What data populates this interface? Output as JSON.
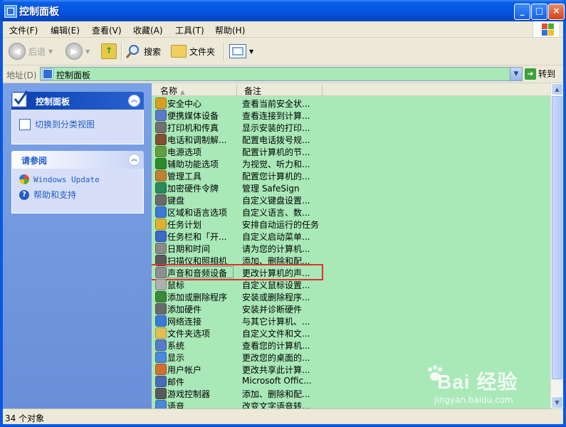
{
  "window": {
    "title": "控制面板"
  },
  "title_buttons": {
    "minimize": "_",
    "maximize": "□",
    "close": "×"
  },
  "menu": [
    "文件(F)",
    "编辑(E)",
    "查看(V)",
    "收藏(A)",
    "工具(T)",
    "帮助(H)"
  ],
  "toolbar": {
    "back": "后退",
    "search": "搜索",
    "folders": "文件夹"
  },
  "address": {
    "label": "地址(D)",
    "value": "控制面板",
    "go": "转到"
  },
  "left_panels": {
    "main": {
      "title": "控制面板",
      "link": "切换到分类视图"
    },
    "see_also": {
      "title": "请参阅",
      "links": [
        "Windows Update",
        "帮助和支持"
      ]
    }
  },
  "columns": {
    "name": "名称",
    "comment": "备注"
  },
  "items": [
    {
      "name": "安全中心",
      "comment": "查看当前安全状...",
      "icon": "shield-icon",
      "color": "#d8a020"
    },
    {
      "name": "便携媒体设备",
      "comment": "查看连接到计算...",
      "icon": "media-device-icon",
      "color": "#5a7ac8"
    },
    {
      "name": "打印机和传真",
      "comment": "显示安装的打印...",
      "icon": "printer-icon",
      "color": "#707070"
    },
    {
      "name": "电话和调制解...",
      "comment": "配置电话拨号规...",
      "icon": "phone-icon",
      "color": "#805030"
    },
    {
      "name": "电源选项",
      "comment": "配置计算机的节...",
      "icon": "power-icon",
      "color": "#60a040"
    },
    {
      "name": "辅助功能选项",
      "comment": "为视觉、听力和...",
      "icon": "accessibility-icon",
      "color": "#2c8c2c"
    },
    {
      "name": "管理工具",
      "comment": "配置您计算机的...",
      "icon": "admin-tools-icon",
      "color": "#c08030"
    },
    {
      "name": "加密硬件令牌",
      "comment": "管理 SafeSign",
      "icon": "token-icon",
      "color": "#2a8a5a"
    },
    {
      "name": "键盘",
      "comment": "自定义键盘设置...",
      "icon": "keyboard-icon",
      "color": "#6a6a6a"
    },
    {
      "name": "区域和语言选项",
      "comment": "自定义语言、数...",
      "icon": "globe-icon",
      "color": "#3a7ad8"
    },
    {
      "name": "任务计划",
      "comment": "安排自动运行的任务",
      "icon": "scheduler-icon",
      "color": "#e0b030"
    },
    {
      "name": "任务栏和「开...",
      "comment": "自定义启动菜单...",
      "icon": "taskbar-icon",
      "color": "#3a6ac8"
    },
    {
      "name": "日期和时间",
      "comment": "请为您的计算机...",
      "icon": "clock-icon",
      "color": "#8a8a8a"
    },
    {
      "name": "扫描仪和照相机",
      "comment": "添加、删除和配...",
      "icon": "scanner-icon",
      "color": "#5a5a5a"
    },
    {
      "name": "声音和音频设备",
      "comment": "更改计算机的声...",
      "icon": "speaker-icon",
      "color": "#909090"
    },
    {
      "name": "鼠标",
      "comment": "自定义鼠标设置...",
      "icon": "mouse-icon",
      "color": "#b0b0b0"
    },
    {
      "name": "添加或删除程序",
      "comment": "安装或删除程序...",
      "icon": "add-remove-icon",
      "color": "#3a8a3a"
    },
    {
      "name": "添加硬件",
      "comment": "安装并诊断硬件",
      "icon": "hardware-icon",
      "color": "#6a6a6a"
    },
    {
      "name": "网络连接",
      "comment": "与其它计算机、...",
      "icon": "network-icon",
      "color": "#3a7ad8"
    },
    {
      "name": "文件夹选项",
      "comment": "自定义文件和文...",
      "icon": "folder-icon",
      "color": "#e0c050"
    },
    {
      "name": "系统",
      "comment": "查看您的计算机...",
      "icon": "computer-icon",
      "color": "#5a7ac8"
    },
    {
      "name": "显示",
      "comment": "更改您的桌面的...",
      "icon": "display-icon",
      "color": "#4a8ad8"
    },
    {
      "name": "用户帐户",
      "comment": "更改共享此计算...",
      "icon": "users-icon",
      "color": "#d07030"
    },
    {
      "name": "邮件",
      "comment": "Microsoft Offic...",
      "icon": "mail-icon",
      "color": "#4a6ab8"
    },
    {
      "name": "游戏控制器",
      "comment": "添加、删除和配...",
      "icon": "gamepad-icon",
      "color": "#5a5a5a"
    },
    {
      "name": "语音",
      "comment": "改变文字语音转...",
      "icon": "speech-icon",
      "color": "#4a8ad8"
    }
  ],
  "selected_item": "声音和音频设备",
  "status": {
    "text": "34 个对象"
  },
  "watermark": {
    "brand": "Bai 经验",
    "url": "jingyan.baidu.com"
  },
  "colors": {
    "accent": "#0a58e0",
    "content_bg": "#a9e8b7",
    "highlight_box": "#e03030"
  }
}
